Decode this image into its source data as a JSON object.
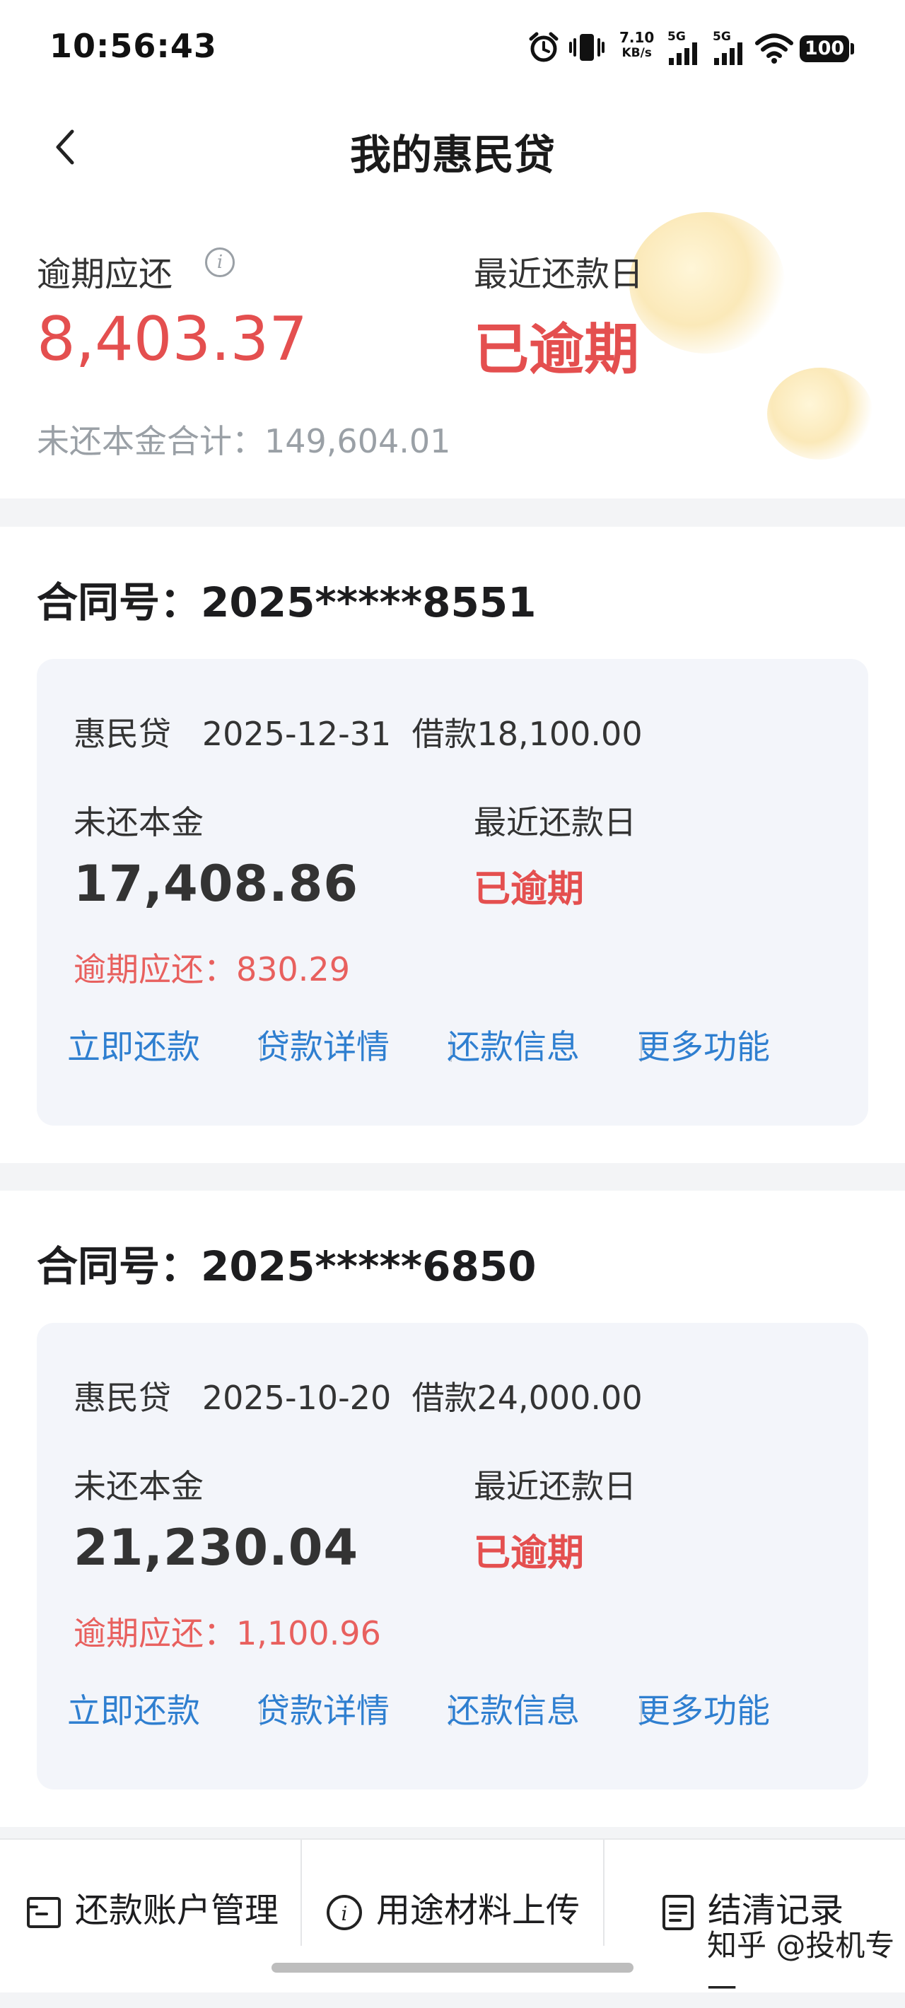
{
  "status_bar": {
    "time": "10:56:43",
    "net_speed_value": "7.10",
    "net_speed_unit": "KB/s",
    "network_1": "5G",
    "network_2": "5G",
    "battery": "100"
  },
  "header": {
    "title": "我的惠民贷"
  },
  "summary": {
    "overdue_label": "逾期应还",
    "overdue_amount": "8,403.37",
    "recent_label": "最近还款日",
    "recent_status": "已逾期",
    "principal_total": "未还本金合计：149,604.01"
  },
  "contracts": [
    {
      "contract_no": "合同号：2025*****8551",
      "product": "惠民贷",
      "date": "2025-12-31",
      "loan": "借款18,100.00",
      "principal_label": "未还本金",
      "principal": "17,408.86",
      "recent_label": "最近还款日",
      "status": "已逾期",
      "overdue": "逾期应还：830.29",
      "actions": [
        "立即还款",
        "贷款详情",
        "还款信息",
        "更多功能"
      ]
    },
    {
      "contract_no": "合同号：2025*****6850",
      "product": "惠民贷",
      "date": "2025-10-20",
      "loan": "借款24,000.00",
      "principal_label": "未还本金",
      "principal": "21,230.04",
      "recent_label": "最近还款日",
      "status": "已逾期",
      "overdue": "逾期应还：1,100.96",
      "actions": [
        "立即还款",
        "贷款详情",
        "还款信息",
        "更多功能"
      ]
    }
  ],
  "bottom_bar": {
    "items": [
      {
        "label": "还款账户管理",
        "icon": "account-icon"
      },
      {
        "label": "用途材料上传",
        "icon": "info-icon"
      },
      {
        "label": "结清记录",
        "icon": "document-icon"
      }
    ]
  },
  "watermark": "知乎 @投机专一",
  "colors": {
    "accent_red": "#e44f4f",
    "link_blue": "#2f7fd0",
    "card_background": "#f3f5fa"
  }
}
